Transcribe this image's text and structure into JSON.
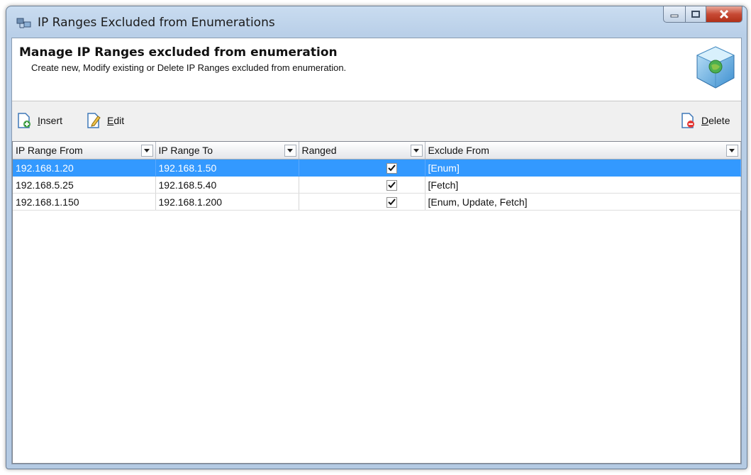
{
  "window": {
    "title": "IP Ranges Excluded from Enumerations"
  },
  "header": {
    "title": "Manage IP Ranges excluded from enumeration",
    "subtitle": "Create new, Modify existing or Delete IP Ranges excluded from enumeration."
  },
  "toolbar": {
    "insert_mnemonic": "I",
    "insert_rest": "nsert",
    "edit_mnemonic": "E",
    "edit_rest": "dit",
    "delete_mnemonic": "D",
    "delete_rest": "elete"
  },
  "grid": {
    "columns": [
      "IP Range From",
      "IP Range To",
      "Ranged",
      "Exclude From"
    ],
    "rows": [
      {
        "from": "192.168.1.20",
        "to": "192.168.1.50",
        "ranged": true,
        "exclude": "[Enum]",
        "selected": true
      },
      {
        "from": "192.168.5.25",
        "to": "192.168.5.40",
        "ranged": true,
        "exclude": "[Fetch]",
        "selected": false
      },
      {
        "from": "192.168.1.150",
        "to": "192.168.1.200",
        "ranged": true,
        "exclude": "[Enum, Update, Fetch]",
        "selected": false
      }
    ]
  },
  "colors": {
    "selection": "#3399ff",
    "close_button": "#c74a35"
  }
}
